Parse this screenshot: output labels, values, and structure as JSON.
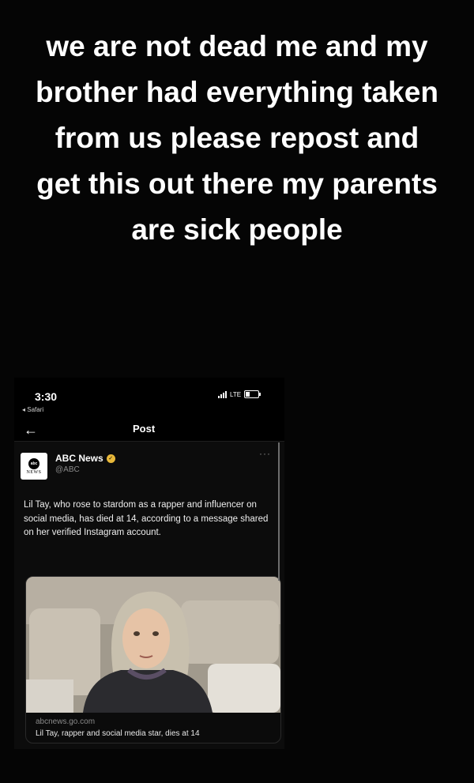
{
  "story": {
    "caption": "we are not dead me and my brother had everything taken from us please repost and get this out there my parents are sick people"
  },
  "phone": {
    "status_bar": {
      "time": "3:30",
      "back_app": "◂ Safari",
      "network": "LTE"
    },
    "nav": {
      "back_icon": "arrow-left-icon",
      "title": "Post"
    }
  },
  "tweet": {
    "avatar": {
      "logo_top": "abc",
      "logo_bottom": "NEWS"
    },
    "display_name": "ABC News",
    "verified_color": "#e8b83a",
    "handle": "@ABC",
    "more": "···",
    "text": "Lil Tay, who rose to stardom as a rapper and influencer on social media, has died at 14, according to a message shared on her verified Instagram account.",
    "link_card": {
      "domain": "abcnews.go.com",
      "title": "Lil Tay, rapper and social media star, dies at 14"
    }
  }
}
